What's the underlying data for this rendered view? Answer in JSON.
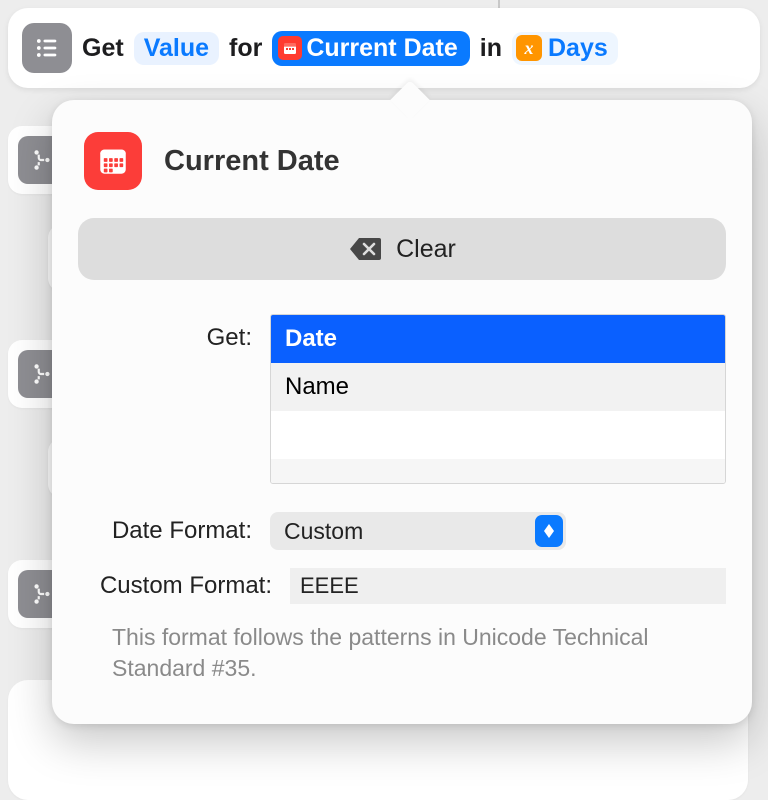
{
  "action_bar": {
    "get": "Get",
    "value_token": "Value",
    "for": "for",
    "current_date_token": "Current Date",
    "in": "in",
    "days_token": "Days"
  },
  "popover": {
    "title": "Current Date",
    "clear_label": "Clear",
    "get_label": "Get:",
    "get_options": {
      "date": "Date",
      "name": "Name"
    },
    "date_format_label": "Date Format:",
    "date_format_value": "Custom",
    "custom_format_label": "Custom Format:",
    "custom_format_value": "EEEE",
    "help_text": "This format follows the patterns in Unicode Technical Standard #35."
  }
}
